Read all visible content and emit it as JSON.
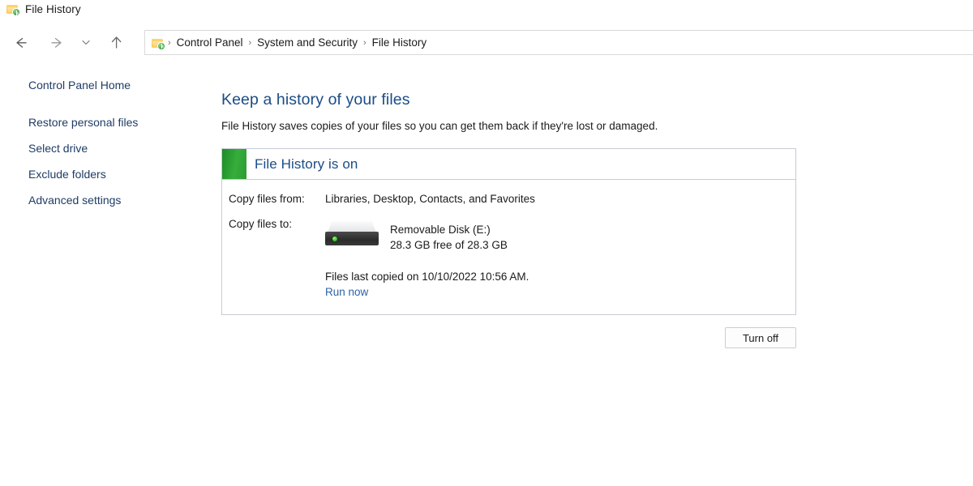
{
  "window": {
    "title": "File History",
    "icon": "file-history-folder-clock-icon"
  },
  "navigation": {
    "back": "back-arrow-icon",
    "forward": "forward-arrow-icon",
    "recent": "chevron-down-icon",
    "up": "up-arrow-icon",
    "breadcrumb": {
      "icon": "file-history-folder-clock-icon",
      "separator": "›",
      "items": [
        "Control Panel",
        "System and Security",
        "File History"
      ]
    }
  },
  "sidebar": {
    "home_label": "Control Panel Home",
    "items": [
      {
        "label": "Restore personal files"
      },
      {
        "label": "Select drive"
      },
      {
        "label": "Exclude folders"
      },
      {
        "label": "Advanced settings"
      }
    ]
  },
  "main": {
    "title": "Keep a history of your files",
    "description": "File History saves copies of your files so you can get them back if they're lost or damaged.",
    "status_panel": {
      "status_color": "#2e9a33",
      "status_heading": "File History is on",
      "copy_from_label": "Copy files from:",
      "copy_from_value": "Libraries, Desktop, Contacts, and Favorites",
      "copy_to_label": "Copy files to:",
      "drive_icon": "external-hard-drive-icon",
      "drive_name": "Removable Disk (E:)",
      "drive_capacity": "28.3 GB free of 28.3 GB",
      "last_copied": "Files last copied on 10/10/2022 10:56 AM.",
      "run_now_label": "Run now"
    },
    "turn_off_label": "Turn off"
  },
  "colors": {
    "heading_blue": "#1b4c87",
    "link_blue": "#2d63a8",
    "sidebar_link": "#1f3c66",
    "status_green": "#2e9a33",
    "panel_border": "#c6cbd4"
  }
}
